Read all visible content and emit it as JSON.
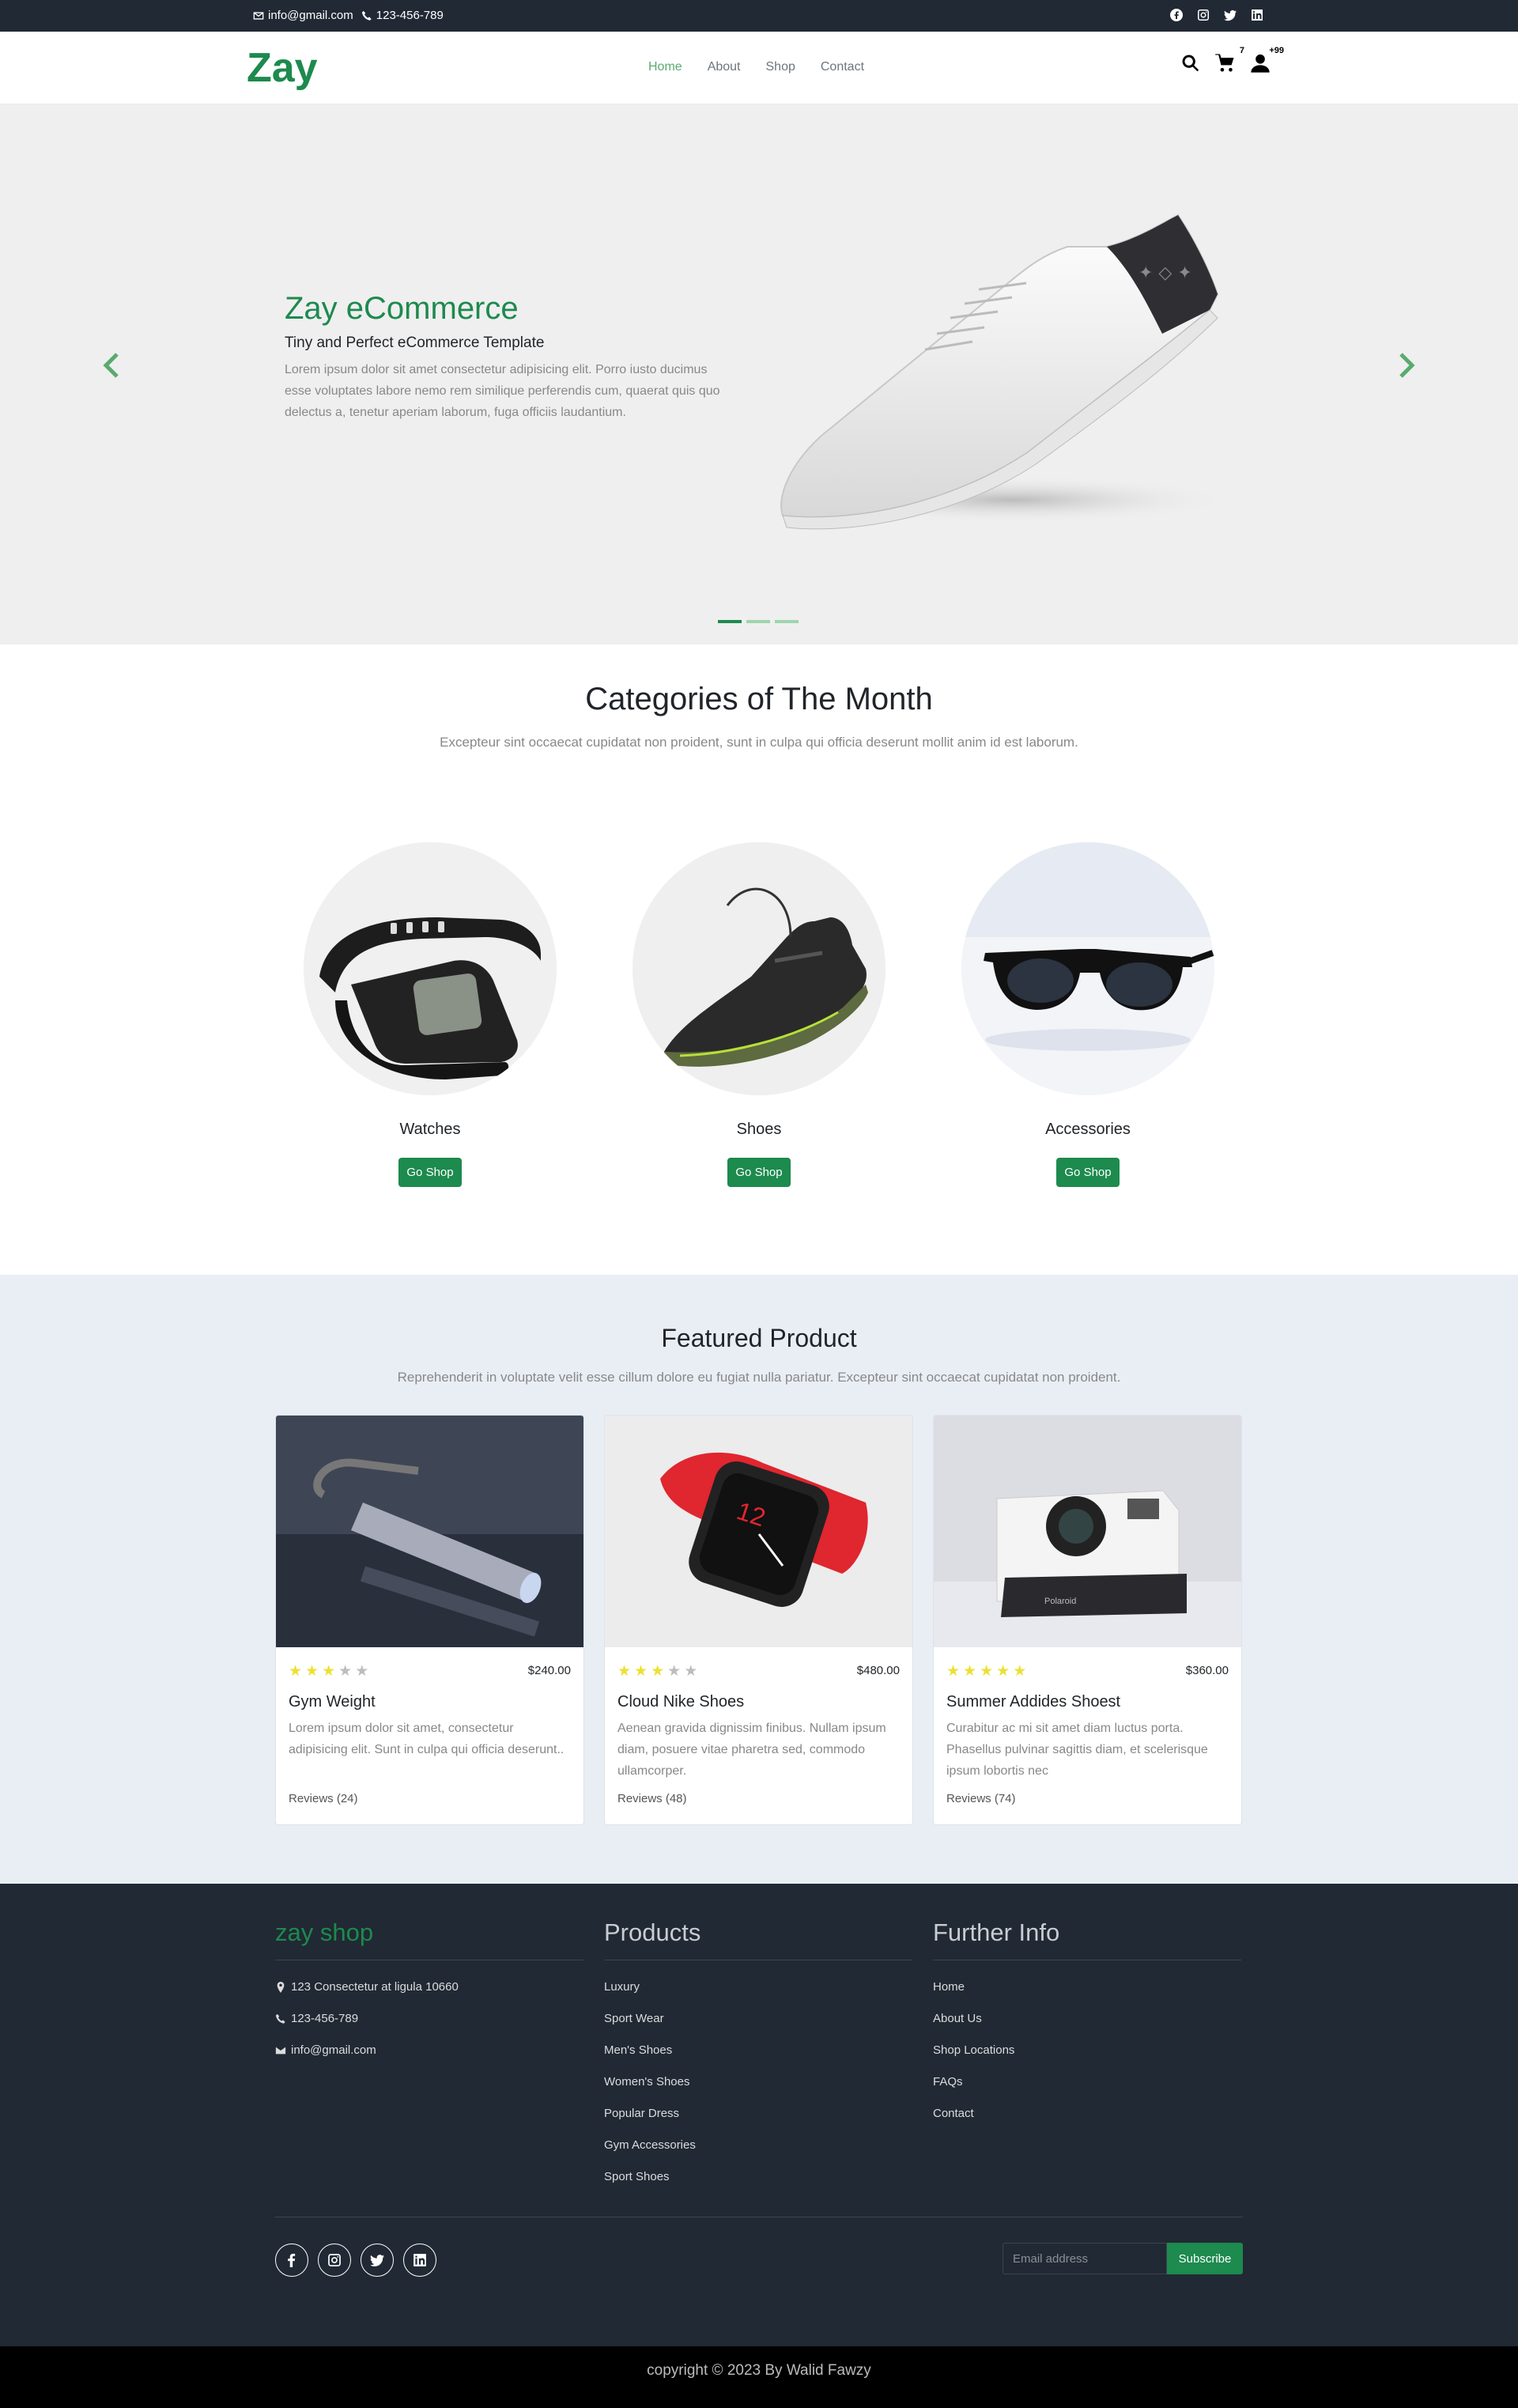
{
  "topbar": {
    "email": "info@gmail.com",
    "phone": "123-456-789",
    "social_icons": [
      "facebook-icon",
      "instagram-icon",
      "twitter-icon",
      "linkedin-icon"
    ]
  },
  "navbar": {
    "brand": "Zay",
    "links": [
      {
        "label": "Home",
        "active": true
      },
      {
        "label": "About",
        "active": false
      },
      {
        "label": "Shop",
        "active": false
      },
      {
        "label": "Contact",
        "active": false
      }
    ],
    "cart_count": "7",
    "user_count": "+99"
  },
  "hero": {
    "title": "Zay eCommerce",
    "subtitle": "Tiny and Perfect eCommerce Template",
    "text": "Lorem ipsum dolor sit amet consectetur adipisicing elit. Porro iusto ducimus esse voluptates labore nemo rem similique perferendis cum, quaerat quis quo delectus a, tenetur aperiam laborum, fuga officiis laudantium.",
    "slide_count": 3,
    "active_slide": 1
  },
  "categories": {
    "title": "Categories of The Month",
    "subtitle": "Excepteur sint occaecat cupidatat non proident, sunt in culpa qui officia deserunt mollit anim id est laborum.",
    "items": [
      {
        "name": "Watches",
        "button": "Go Shop"
      },
      {
        "name": "Shoes",
        "button": "Go Shop"
      },
      {
        "name": "Accessories",
        "button": "Go Shop"
      }
    ]
  },
  "featured": {
    "title": "Featured Product",
    "subtitle": "Reprehenderit in voluptate velit esse cillum dolore eu fugiat nulla pariatur. Excepteur sint occaecat cupidatat non proident.",
    "products": [
      {
        "name": "Gym Weight",
        "price": "$240.00",
        "rating": 3,
        "description": "Lorem ipsum dolor sit amet, consectetur adipisicing elit. Sunt in culpa qui officia deserunt..",
        "reviews": "Reviews (24)"
      },
      {
        "name": "Cloud Nike Shoes",
        "price": "$480.00",
        "rating": 3,
        "description": "Aenean gravida dignissim finibus. Nullam ipsum diam, posuere vitae pharetra sed, commodo ullamcorper.",
        "reviews": "Reviews (48)"
      },
      {
        "name": "Summer Addides Shoest",
        "price": "$360.00",
        "rating": 5,
        "description": "Curabitur ac mi sit amet diam luctus porta. Phasellus pulvinar sagittis diam, et scelerisque ipsum lobortis nec",
        "reviews": "Reviews (74)"
      }
    ]
  },
  "footer": {
    "shop": {
      "title": "zay shop",
      "address": "123 Consectetur at ligula 10660",
      "phone": "123-456-789",
      "email": "info@gmail.com"
    },
    "products": {
      "title": "Products",
      "items": [
        "Luxury",
        "Sport Wear",
        "Men's Shoes",
        "Women's Shoes",
        "Popular Dress",
        "Gym Accessories",
        "Sport Shoes"
      ]
    },
    "info": {
      "title": "Further Info",
      "items": [
        "Home",
        "About Us",
        "Shop Locations",
        "FAQs",
        "Contact"
      ]
    },
    "email_placeholder": "Email address",
    "subscribe_label": "Subscribe",
    "copyright": "copyright © 2023 By Walid Fawzy"
  },
  "colors": {
    "accent_green": "#1d8a4e",
    "light_green": "#59ab6e",
    "dark_bg": "#212934",
    "star_on": "#ece134"
  }
}
